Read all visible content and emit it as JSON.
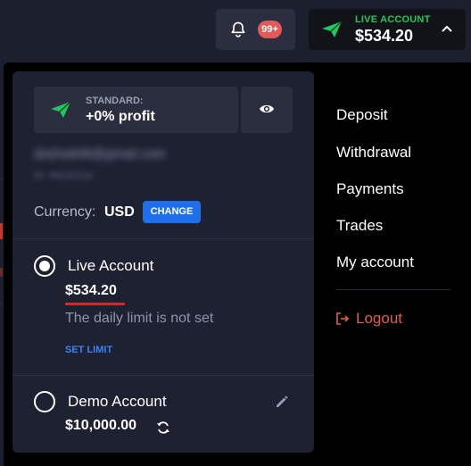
{
  "topbar": {
    "notification_count": "99+",
    "account_kind": "LIVE ACCOUNT",
    "account_balance": "$534.20"
  },
  "profile": {
    "plan_name": "STANDARD:",
    "plan_profit": "+0% profit",
    "email": "dashaleltt@gmail.com",
    "user_id": "ID: 59132214",
    "currency_label": "Currency:",
    "currency_value": "USD",
    "change_label": "CHANGE"
  },
  "accounts": {
    "live": {
      "title": "Live Account",
      "balance": "$534.20",
      "limit_text": "The daily limit is not set",
      "set_limit_label": "SET LIMIT",
      "selected": true
    },
    "demo": {
      "title": "Demo Account",
      "balance": "$10,000.00",
      "selected": false
    }
  },
  "menu": {
    "items": [
      "Deposit",
      "Withdrawal",
      "Payments",
      "Trades",
      "My account"
    ],
    "logout_label": "Logout"
  },
  "colors": {
    "accent_green": "#22c55e",
    "accent_blue": "#1f6feb",
    "logout_red": "#e35d4f",
    "badge_red": "#e35959"
  },
  "icons": [
    "bell-icon",
    "paper-plane-icon",
    "chevron-up-icon",
    "eye-icon",
    "pencil-icon",
    "refresh-icon",
    "logout-icon"
  ]
}
